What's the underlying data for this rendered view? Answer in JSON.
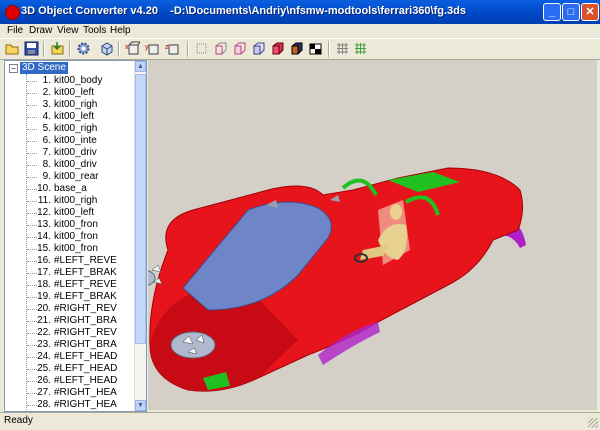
{
  "window": {
    "title": "3D Object Converter v4.20    -D:\\Documents\\Andriy\\nfsmw-modtools\\ferrari360\\fg.3ds",
    "minimize": "_",
    "maximize": "□",
    "close": "✕"
  },
  "menu": [
    {
      "label": "File"
    },
    {
      "label": "Draw"
    },
    {
      "label": "View"
    },
    {
      "label": "Tools"
    },
    {
      "label": "Help"
    }
  ],
  "toolbar_icons": [
    "open-folder-icon",
    "save-disk-icon",
    "import-icon",
    "settings-gear-icon",
    "cube-icon",
    "cube-x-icon",
    "cube-y-icon",
    "cube-z-icon",
    "wire-cube-icon",
    "front-view-icon",
    "side-view-icon",
    "top-view-icon",
    "solid-cube-icon",
    "shaded-cube-icon",
    "checker-cube-icon",
    "grid-icon",
    "green-grid-icon"
  ],
  "tree": {
    "root_label": "3D Scene",
    "items": [
      {
        "num": "1.",
        "name": "kit00_body"
      },
      {
        "num": "2.",
        "name": "kit00_left"
      },
      {
        "num": "3.",
        "name": "kit00_righ"
      },
      {
        "num": "4.",
        "name": "kit00_left"
      },
      {
        "num": "5.",
        "name": "kit00_righ"
      },
      {
        "num": "6.",
        "name": "kit00_inte"
      },
      {
        "num": "7.",
        "name": "kit00_driv"
      },
      {
        "num": "8.",
        "name": "kit00_driv"
      },
      {
        "num": "9.",
        "name": "kit00_rear"
      },
      {
        "num": "10.",
        "name": "base_a"
      },
      {
        "num": "11.",
        "name": "kit00_righ"
      },
      {
        "num": "12.",
        "name": "kit00_left"
      },
      {
        "num": "13.",
        "name": "kit00_fron"
      },
      {
        "num": "14.",
        "name": "kit00_fron"
      },
      {
        "num": "15.",
        "name": "kit00_fron"
      },
      {
        "num": "16.",
        "name": "#LEFT_REVE"
      },
      {
        "num": "17.",
        "name": "#LEFT_BRAK"
      },
      {
        "num": "18.",
        "name": "#LEFT_REVE"
      },
      {
        "num": "19.",
        "name": "#LEFT_BRAK"
      },
      {
        "num": "20.",
        "name": "#RIGHT_REV"
      },
      {
        "num": "21.",
        "name": "#RIGHT_BRA"
      },
      {
        "num": "22.",
        "name": "#RIGHT_REV"
      },
      {
        "num": "23.",
        "name": "#RIGHT_BRA"
      },
      {
        "num": "24.",
        "name": "#LEFT_HEAD"
      },
      {
        "num": "25.",
        "name": "#LEFT_HEAD"
      },
      {
        "num": "26.",
        "name": "#LEFT_HEAD"
      },
      {
        "num": "27.",
        "name": "#RIGHT_HEA"
      },
      {
        "num": "28.",
        "name": "#RIGHT_HEA"
      }
    ]
  },
  "status": {
    "text": "Ready"
  },
  "colors": {
    "titlebar": "#0054e3",
    "viewport_bg": "#d4d0c8",
    "car_body": "#e8141c",
    "glass": "#6e86c8",
    "trim_magenta": "#b020c8",
    "accent_green": "#20c020"
  }
}
